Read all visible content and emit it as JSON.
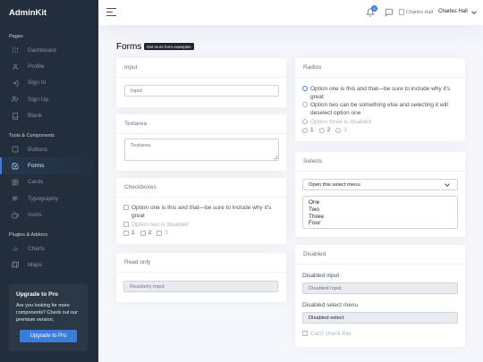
{
  "brand": "AdminKit",
  "sidebar": {
    "sections": [
      {
        "header": "Pages",
        "items": [
          {
            "label": "Dashboard",
            "icon": "sliders-icon"
          },
          {
            "label": "Profile",
            "icon": "user-icon"
          },
          {
            "label": "Sign In",
            "icon": "log-in-icon"
          },
          {
            "label": "Sign Up",
            "icon": "user-plus-icon"
          },
          {
            "label": "Blank",
            "icon": "book-icon"
          }
        ]
      },
      {
        "header": "Tools & Components",
        "items": [
          {
            "label": "Buttons",
            "icon": "square-icon"
          },
          {
            "label": "Forms",
            "icon": "check-square-icon",
            "active": true
          },
          {
            "label": "Cards",
            "icon": "grid-icon"
          },
          {
            "label": "Typography",
            "icon": "align-left-icon"
          },
          {
            "label": "Icons",
            "icon": "coffee-icon"
          }
        ]
      },
      {
        "header": "Plugins & Addons",
        "items": [
          {
            "label": "Charts",
            "icon": "bar-chart-icon"
          },
          {
            "label": "Maps",
            "icon": "map-icon"
          }
        ]
      }
    ],
    "upgrade": {
      "title": "Upgrade to Pro",
      "text": "Are you looking for more components? Check out our premium version.",
      "button": "Upgrade to Pro"
    }
  },
  "topbar": {
    "notification_count": "4",
    "avatar_alt": "Charles Hall",
    "user_name": "Charles Hall"
  },
  "page": {
    "title": "Forms",
    "pill": "Get more form examples"
  },
  "cards": {
    "input": {
      "title": "Input",
      "placeholder": "Input"
    },
    "textarea": {
      "title": "Textarea",
      "placeholder": "Textarea"
    },
    "checkboxes": {
      "title": "Checkboxes",
      "opt1": "Option one is this and that—be sure to include why it's great",
      "opt2": "Option two is disabled",
      "inline": [
        "1",
        "2",
        "3"
      ]
    },
    "readonly": {
      "title": "Read only",
      "placeholder": "Readonly input"
    },
    "radios": {
      "title": "Radios",
      "opt1": "Option one is this and that—be sure to include why it's great",
      "opt2": "Option two can be something else and selecting it will deselect option one",
      "opt3": "Option three is disabled",
      "inline": [
        "1",
        "2",
        "3"
      ]
    },
    "selects": {
      "title": "Selects",
      "selected": "Open this select menu",
      "options": [
        "One",
        "Two",
        "Three",
        "Four"
      ]
    },
    "disabled": {
      "title": "Disabled",
      "input_label": "Disabled input",
      "input_placeholder": "Disabled input",
      "select_label": "Disabled select menu",
      "select_value": "Disabled select",
      "check_label": "Can't check this"
    }
  }
}
